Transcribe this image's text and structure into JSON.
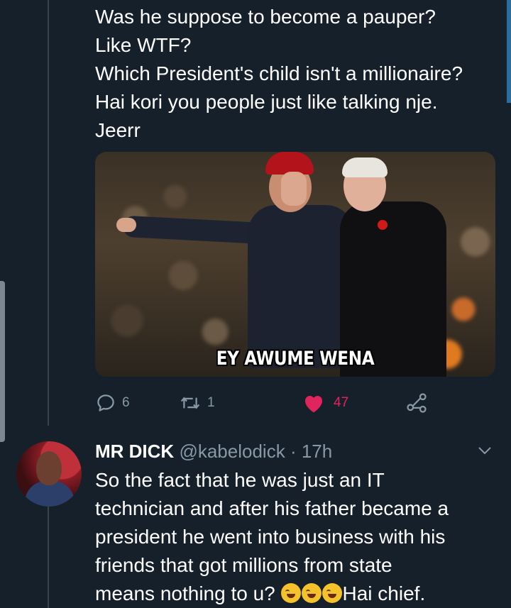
{
  "tweet": {
    "lines": [
      "Was he suppose to become a pauper?",
      "Like WTF?",
      "Which President's child isn't a millionaire?",
      "Hai kori you people just like talking nje.",
      "Jeerr"
    ],
    "meme_caption": "EY AWUME WENA",
    "replies_count": "6",
    "retweets_count": "1",
    "likes_count": "47"
  },
  "reply": {
    "name": "MR DICK",
    "handle": "@kabelodick",
    "separator": "·",
    "time": "17h",
    "lines": [
      "So the fact that he was just an IT",
      "technician and after his father became a",
      "president he went into business with his",
      "friends that got millions from state"
    ],
    "last_line_text": "means nothing to u? ",
    "last_line_suffix": "Hai chief."
  },
  "icons": {
    "reply": "reply-icon",
    "retweet": "retweet-icon",
    "like": "heart-icon",
    "share": "share-icon",
    "more": "chevron-down-icon",
    "emoji": "rolling-on-floor-laughing-emoji"
  },
  "colors": {
    "background": "#15202b",
    "secondary_text": "#8899a6",
    "like": "#e0245e"
  }
}
